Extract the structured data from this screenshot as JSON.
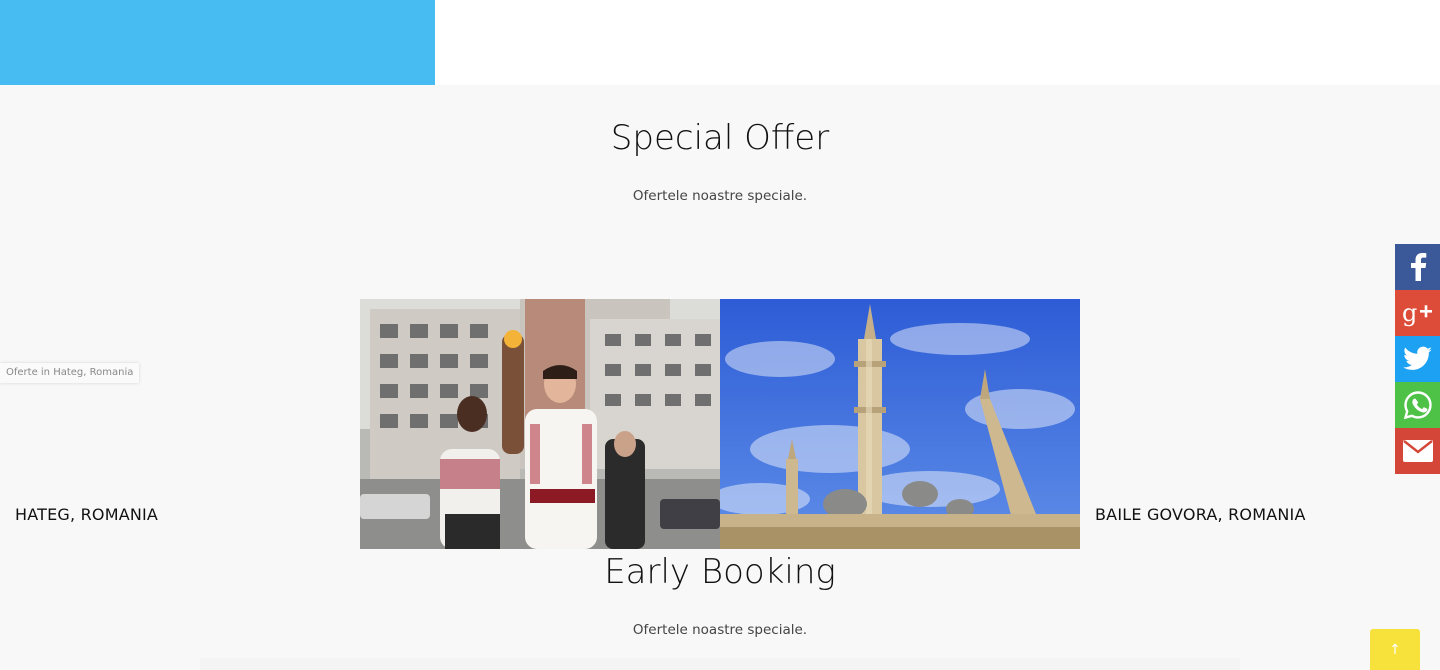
{
  "header": {
    "brand_color": "#47bcf2"
  },
  "special_offer": {
    "title": "Special Offer",
    "subtitle": "Ofertele noastre speciale."
  },
  "carousel": {
    "tooltip": "Oferte in Hateg, Romania",
    "left_label": "HATEG, ROMANIA",
    "right_label": "BAILE GOVORA, ROMANIA",
    "left_image_icon": "city-street-parade-photo",
    "right_image_icon": "mosque-minarets-photo"
  },
  "early_booking": {
    "title": "Early Booking",
    "subtitle": "Ofertele noastre speciale."
  },
  "share_bar": {
    "items": [
      {
        "name": "facebook",
        "icon": "facebook-icon",
        "color": "#3b5998"
      },
      {
        "name": "google-plus",
        "icon": "google-plus-icon",
        "color": "#dd4b39"
      },
      {
        "name": "twitter",
        "icon": "twitter-icon",
        "color": "#1da1f2"
      },
      {
        "name": "whatsapp",
        "icon": "whatsapp-icon",
        "color": "#4dc247"
      },
      {
        "name": "email",
        "icon": "email-icon",
        "color": "#d44638"
      }
    ]
  },
  "scroll_top": {
    "glyph": "↑",
    "color": "#f7e13b"
  }
}
